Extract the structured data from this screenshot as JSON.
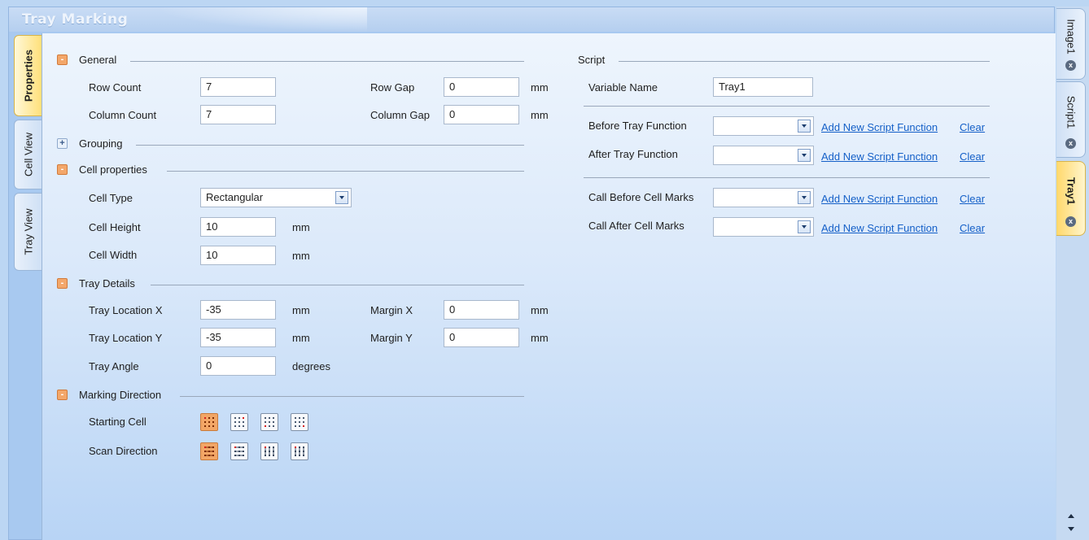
{
  "window": {
    "title": "Tray Marking"
  },
  "left_tabs": [
    "Properties",
    "Cell View",
    "Tray View"
  ],
  "right_tabs": [
    "Image1",
    "Script1",
    "Tray1"
  ],
  "general": {
    "title": "General",
    "row_count_label": "Row Count",
    "row_count": "7",
    "row_gap_label": "Row Gap",
    "row_gap": "0",
    "row_gap_unit": "mm",
    "column_count_label": "Column Count",
    "column_count": "7",
    "column_gap_label": "Column Gap",
    "column_gap": "0",
    "column_gap_unit": "mm"
  },
  "grouping": {
    "title": "Grouping"
  },
  "cell_properties": {
    "title": "Cell properties",
    "cell_type_label": "Cell Type",
    "cell_type": "Rectangular",
    "cell_height_label": "Cell Height",
    "cell_height": "10",
    "cell_height_unit": "mm",
    "cell_width_label": "Cell Width",
    "cell_width": "10",
    "cell_width_unit": "mm"
  },
  "tray_details": {
    "title": "Tray Details",
    "loc_x_label": "Tray Location X",
    "loc_x": "-35",
    "loc_x_unit": "mm",
    "margin_x_label": "Margin X",
    "margin_x": "0",
    "margin_x_unit": "mm",
    "loc_y_label": "Tray Location Y",
    "loc_y": "-35",
    "loc_y_unit": "mm",
    "margin_y_label": "Margin Y",
    "margin_y": "0",
    "margin_y_unit": "mm",
    "angle_label": "Tray Angle",
    "angle": "0",
    "angle_unit": "degrees"
  },
  "marking_direction": {
    "title": "Marking Direction",
    "starting_cell_label": "Starting Cell",
    "scan_direction_label": "Scan Direction"
  },
  "script": {
    "title": "Script",
    "variable_name_label": "Variable Name",
    "variable_name": "Tray1",
    "before_tray_label": "Before Tray Function",
    "after_tray_label": "After Tray Function",
    "before_cell_label": "Call Before Cell Marks",
    "after_cell_label": "Call After Cell Marks",
    "add_link": "Add New Script Function",
    "clear_link": "Clear"
  },
  "icons": {
    "collapse": "-",
    "expand": "+",
    "close": "x"
  },
  "colors": {
    "accent_selected": "#f2a666",
    "link": "#1560c8",
    "active_tab": "#ffe07a"
  }
}
